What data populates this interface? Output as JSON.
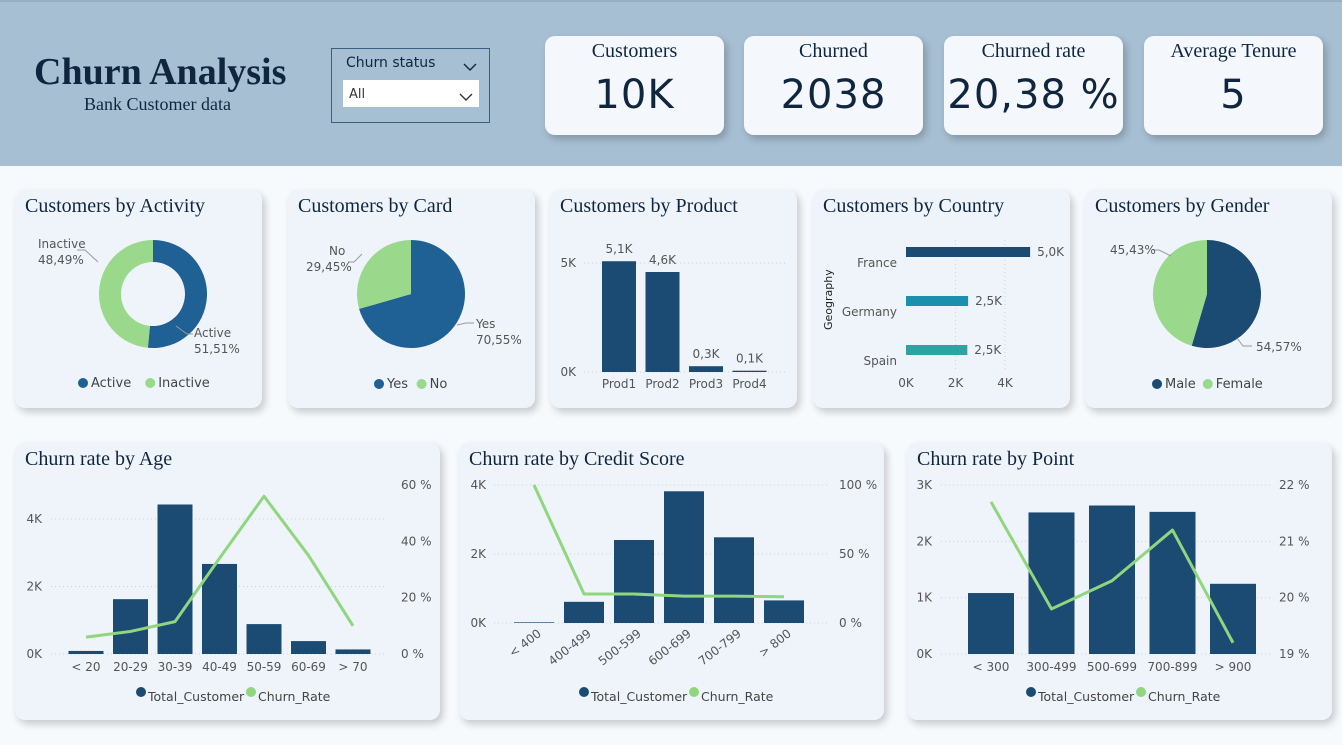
{
  "colors": {
    "navy": "#1b4a72",
    "blue": "#1f6095",
    "light_green": "#9ad98b",
    "teal": "#1c8fad",
    "teal2": "#30a2a2",
    "line_green": "#90d67e",
    "header_bg": "#a7bfd3",
    "text": "#10263f"
  },
  "header": {
    "title": "Churn Analysis",
    "subtitle": "Bank Customer data"
  },
  "slicer": {
    "label": "Churn status",
    "value": "All"
  },
  "kpis": [
    {
      "label": "Customers",
      "value": "10K"
    },
    {
      "label": "Churned",
      "value": "2038"
    },
    {
      "label": "Churned rate",
      "value": "20,38 %"
    },
    {
      "label": "Average Tenure",
      "value": "5"
    }
  ],
  "cards": {
    "activity": "Customers by Activity",
    "card": "Customers by Card",
    "product": "Customers by Product",
    "country": "Customers by Country",
    "gender": "Customers by Gender",
    "age": "Churn rate by Age",
    "credit": "Churn rate by Credit Score",
    "point": "Churn rate by Point"
  },
  "chart_data": [
    {
      "id": "activity",
      "type": "pie",
      "donut": true,
      "slices": [
        {
          "label": "Active",
          "pct_label": "51,51%",
          "value": 51.51,
          "color": "#1f6095"
        },
        {
          "label": "Inactive",
          "pct_label": "48,49%",
          "value": 48.49,
          "color": "#9ad98b"
        }
      ],
      "legend": [
        "Active",
        "Inactive"
      ]
    },
    {
      "id": "card",
      "type": "pie",
      "slices": [
        {
          "label": "Yes",
          "pct_label": "70,55%",
          "value": 70.55,
          "color": "#1f6095"
        },
        {
          "label": "No",
          "pct_label": "29,45%",
          "value": 29.45,
          "color": "#9ad98b"
        }
      ],
      "legend": [
        "Yes",
        "No"
      ]
    },
    {
      "id": "product",
      "type": "bar",
      "categories": [
        "Prod1",
        "Prod2",
        "Prod3",
        "Prod4"
      ],
      "values": [
        5084,
        4590,
        266,
        60
      ],
      "data_labels": [
        "5,1K",
        "4,6K",
        "0,3K",
        "0,1K"
      ],
      "yticks": [
        "0K",
        "5K"
      ],
      "ylim": [
        0,
        5600
      ]
    },
    {
      "id": "country",
      "type": "bar",
      "orientation": "horizontal",
      "categories": [
        "France",
        "Germany",
        "Spain"
      ],
      "values": [
        5014,
        2509,
        2477
      ],
      "data_labels": [
        "5,0K",
        "2,5K",
        "2,5K"
      ],
      "colors": [
        "#1b4a72",
        "#1c8fad",
        "#30a2a2"
      ],
      "ylabel": "Geography",
      "xticks": [
        "0K",
        "2K",
        "4K"
      ],
      "xlim": [
        0,
        5000
      ]
    },
    {
      "id": "gender",
      "type": "pie",
      "slices": [
        {
          "label": "Male",
          "pct_label": "54,57%",
          "value": 54.57,
          "color": "#1b4a72"
        },
        {
          "label": "Female",
          "pct_label": "45,43%",
          "value": 45.43,
          "color": "#9ad98b"
        }
      ],
      "legend": [
        "Male",
        "Female"
      ]
    },
    {
      "id": "age",
      "type": "bar+line",
      "categories": [
        "< 20",
        "20-29",
        "30-39",
        "40-49",
        "50-59",
        "60-69",
        "> 70"
      ],
      "series": [
        {
          "name": "Total_Customer",
          "values": [
            89,
            1594,
            4346,
            2618,
            869,
            375,
            133
          ]
        },
        {
          "name": "Churn_Rate",
          "values": [
            6,
            8,
            11.5,
            34,
            56,
            35,
            10
          ]
        }
      ],
      "yticks_left": [
        "0K",
        "2K",
        "4K"
      ],
      "ylim_left": [
        0,
        5000
      ],
      "yticks_right": [
        "0 %",
        "20 %",
        "40 %",
        "60 %"
      ],
      "ylim_right": [
        0,
        60
      ],
      "legend": [
        "Total_Customer",
        "Churn_Rate"
      ]
    },
    {
      "id": "credit",
      "type": "bar+line",
      "categories": [
        "< 400",
        "400-499",
        "500-599",
        "600-699",
        "700-799",
        "> 800"
      ],
      "series": [
        {
          "name": "Total_Customer",
          "values": [
            19,
            614,
            2406,
            3818,
            2484,
            655
          ]
        },
        {
          "name": "Churn_Rate",
          "values": [
            100,
            21,
            21,
            19.5,
            19.5,
            19
          ]
        }
      ],
      "yticks_left": [
        "0K",
        "2K",
        "4K"
      ],
      "ylim_left": [
        0,
        4000
      ],
      "yticks_right": [
        "0 %",
        "50 %",
        "100 %"
      ],
      "ylim_right": [
        0,
        100
      ],
      "legend": [
        "Total_Customer",
        "Churn_Rate"
      ]
    },
    {
      "id": "point",
      "type": "bar+line",
      "categories": [
        "< 300",
        "300-499",
        "500-699",
        "700-899",
        "> 900"
      ],
      "series": [
        {
          "name": "Total_Customer",
          "values": [
            1082,
            2513,
            2636,
            2523,
            1246
          ]
        },
        {
          "name": "Churn_Rate",
          "values": [
            21.7,
            19.8,
            20.3,
            21.2,
            19.2
          ]
        }
      ],
      "yticks_left": [
        "0K",
        "1K",
        "2K",
        "3K"
      ],
      "ylim_left": [
        0,
        3000
      ],
      "yticks_right": [
        "19 %",
        "20 %",
        "21 %",
        "22 %"
      ],
      "ylim_right": [
        19,
        22
      ],
      "legend": [
        "Total_Customer",
        "Churn_Rate"
      ]
    }
  ]
}
